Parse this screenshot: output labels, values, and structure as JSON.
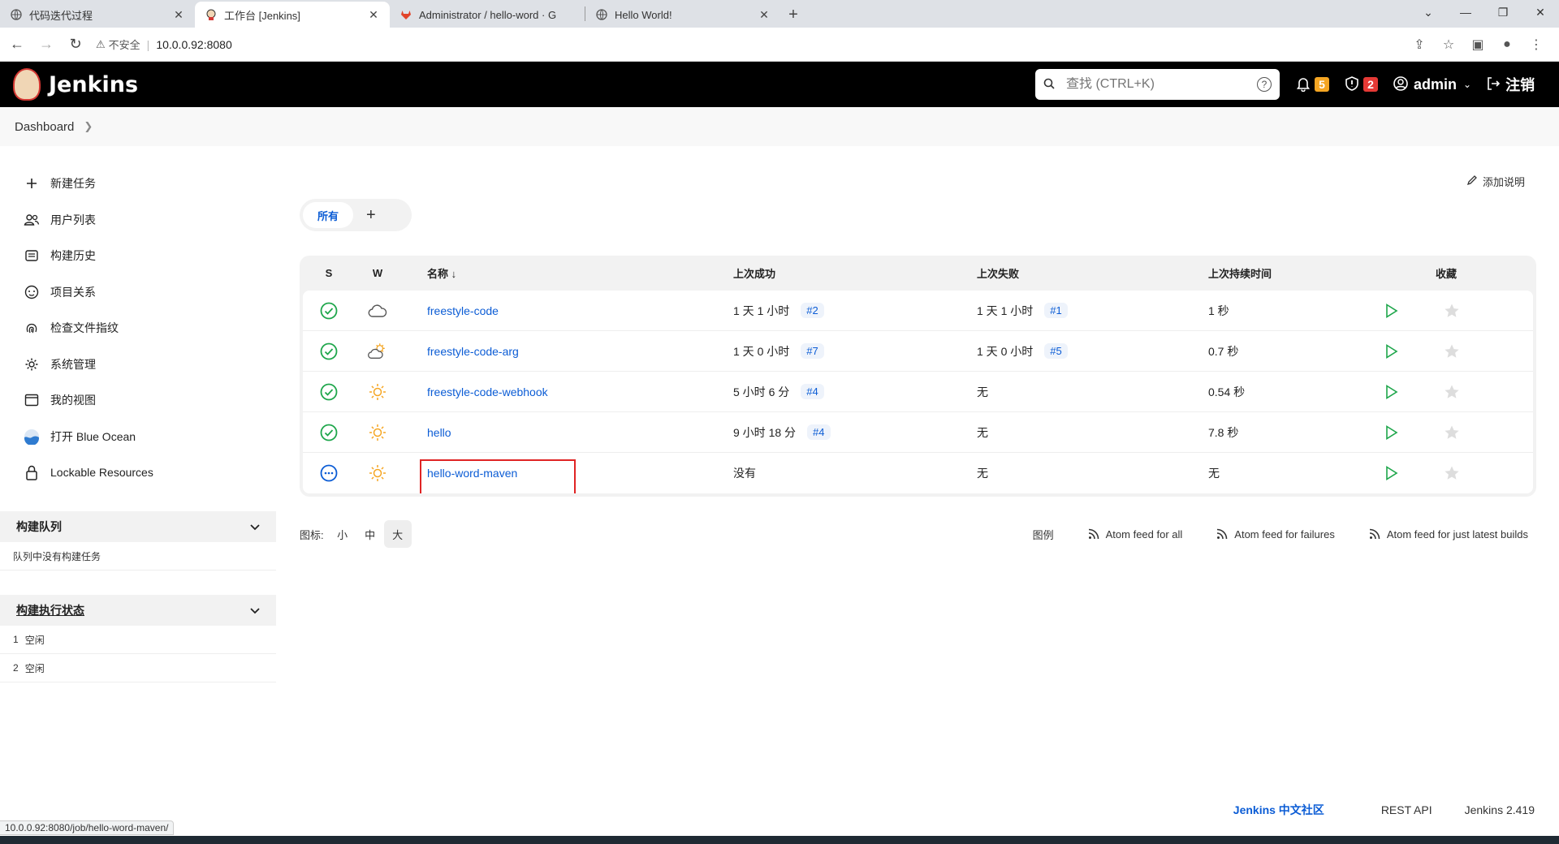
{
  "browser": {
    "tabs": [
      {
        "title": "代码迭代过程",
        "active": false
      },
      {
        "title": "工作台 [Jenkins]",
        "active": true
      },
      {
        "title": "Administrator / hello-word · G",
        "active": false
      },
      {
        "title": "Hello World!",
        "active": false
      }
    ],
    "security_label": "不安全",
    "url": "10.0.0.92:8080"
  },
  "header": {
    "brand": "Jenkins",
    "search_placeholder": "查找 (CTRL+K)",
    "notifications_count": "5",
    "security_count": "2",
    "user": "admin",
    "logout": "注销"
  },
  "breadcrumb": {
    "item": "Dashboard"
  },
  "sidebar": {
    "tasks": [
      {
        "label": "新建任务",
        "icon": "plus-icon"
      },
      {
        "label": "用户列表",
        "icon": "people-icon"
      },
      {
        "label": "构建历史",
        "icon": "history-icon"
      },
      {
        "label": "项目关系",
        "icon": "relations-icon"
      },
      {
        "label": "检查文件指纹",
        "icon": "fingerprint-icon"
      },
      {
        "label": "系统管理",
        "icon": "gear-icon"
      },
      {
        "label": "我的视图",
        "icon": "window-icon"
      },
      {
        "label": "打开 Blue Ocean",
        "icon": "blue-ocean-icon"
      },
      {
        "label": "Lockable Resources",
        "icon": "lock-icon"
      }
    ],
    "queue": {
      "title": "构建队列",
      "empty": "队列中没有构建任务"
    },
    "executors": {
      "title": "构建执行状态",
      "rows": [
        {
          "num": "1",
          "status": "空闲"
        },
        {
          "num": "2",
          "status": "空闲"
        }
      ]
    }
  },
  "main": {
    "add_description": "添加说明",
    "view_tab": "所有",
    "columns": {
      "s": "S",
      "w": "W",
      "name": "名称 ↓",
      "last_success": "上次成功",
      "last_failure": "上次失败",
      "last_duration": "上次持续时间",
      "favorite": "收藏"
    },
    "jobs": [
      {
        "name": "freestyle-code",
        "status": "success",
        "weather": "cloudy",
        "last_success": "1 天 1 小时",
        "last_success_build": "#2",
        "last_failure": "1 天 1 小时",
        "last_failure_build": "#1",
        "duration": "1 秒"
      },
      {
        "name": "freestyle-code-arg",
        "status": "success",
        "weather": "partly-sunny",
        "last_success": "1 天 0 小时",
        "last_success_build": "#7",
        "last_failure": "1 天 0 小时",
        "last_failure_build": "#5",
        "duration": "0.7 秒"
      },
      {
        "name": "freestyle-code-webhook",
        "status": "success",
        "weather": "sunny",
        "last_success": "5 小时 6 分",
        "last_success_build": "#4",
        "last_failure": "无",
        "last_failure_build": "",
        "duration": "0.54 秒"
      },
      {
        "name": "hello",
        "status": "success",
        "weather": "sunny",
        "last_success": "9 小时 18 分",
        "last_success_build": "#4",
        "last_failure": "无",
        "last_failure_build": "",
        "duration": "7.8 秒"
      },
      {
        "name": "hello-word-maven",
        "status": "not-built",
        "weather": "sunny",
        "last_success": "没有",
        "last_success_build": "",
        "last_failure": "无",
        "last_failure_build": "",
        "duration": "无"
      }
    ],
    "icon_size": {
      "label": "图标:",
      "small": "小",
      "medium": "中",
      "large": "大"
    },
    "legend": "图例",
    "feeds": {
      "all": "Atom feed for all",
      "failures": "Atom feed for failures",
      "latest": "Atom feed for just latest builds"
    }
  },
  "footer": {
    "community": "Jenkins 中文社区",
    "rest_api": "REST API",
    "version": "Jenkins 2.419"
  },
  "status_url": "10.0.0.92:8080/job/hello-word-maven/",
  "colors": {
    "link": "#0b5cd5",
    "success": "#1ea64b",
    "highlight": "#e02424",
    "sun": "#f5a623"
  }
}
